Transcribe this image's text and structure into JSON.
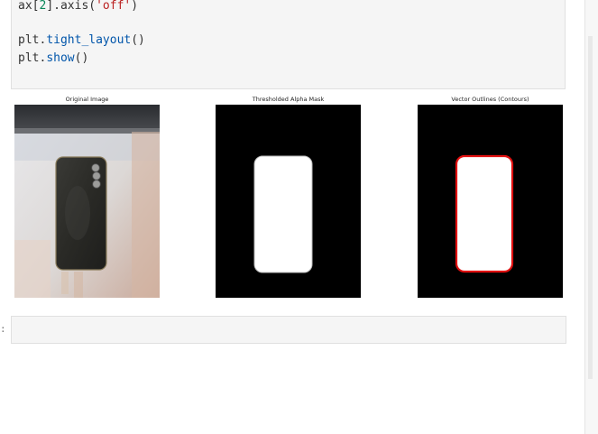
{
  "code_cell": {
    "line1": {
      "var": "ax",
      "open_bracket": "[",
      "index": "2",
      "close_bracket": "]",
      "method": ".axis",
      "open_paren": "(",
      "arg": "'off'",
      "close_paren": ")"
    },
    "line3": {
      "obj": "plt",
      "dot": ".",
      "method": "tight_layout",
      "call": "()"
    },
    "line4": {
      "obj": "plt",
      "dot": ".",
      "method": "show",
      "call": "()"
    }
  },
  "figure": {
    "panels": [
      {
        "title": "Original Image",
        "icon": "photo-image"
      },
      {
        "title": "Thresholded Alpha Mask",
        "icon": "mask-image"
      },
      {
        "title": "Vector Outlines (Contours)",
        "icon": "contour-image"
      }
    ]
  },
  "empty_cell": {
    "prompt": ":"
  },
  "colors": {
    "cell_background": "#f5f5f5",
    "contour": "#e01010",
    "mask_background": "#000000"
  }
}
